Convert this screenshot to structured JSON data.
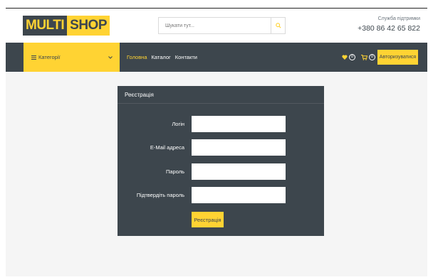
{
  "header": {
    "logo_part1": "MULTI",
    "logo_part2": "SHOP",
    "search_placeholder": "Шукати тут...",
    "support_label": "Служба підтримки",
    "support_phone": "+380 86 42 65 822"
  },
  "nav": {
    "categories_label": "Категорії",
    "links": [
      {
        "label": "Головна",
        "active": true
      },
      {
        "label": "Каталог",
        "active": false
      },
      {
        "label": "Контакти",
        "active": false
      }
    ],
    "wishlist_count": "0",
    "cart_count": "0",
    "auth_button": "Авторизуватися"
  },
  "form": {
    "title": "Реєстрація",
    "fields": [
      {
        "label": "Логін",
        "value": ""
      },
      {
        "label": "E-Mail адреса",
        "value": ""
      },
      {
        "label": "Пароль",
        "value": ""
      },
      {
        "label": "Підтвердіть пароль",
        "value": ""
      }
    ],
    "submit_label": "Реєстрація"
  },
  "colors": {
    "accent": "#ffd333",
    "dark": "#3d464d",
    "background": "#f5f5f5"
  }
}
